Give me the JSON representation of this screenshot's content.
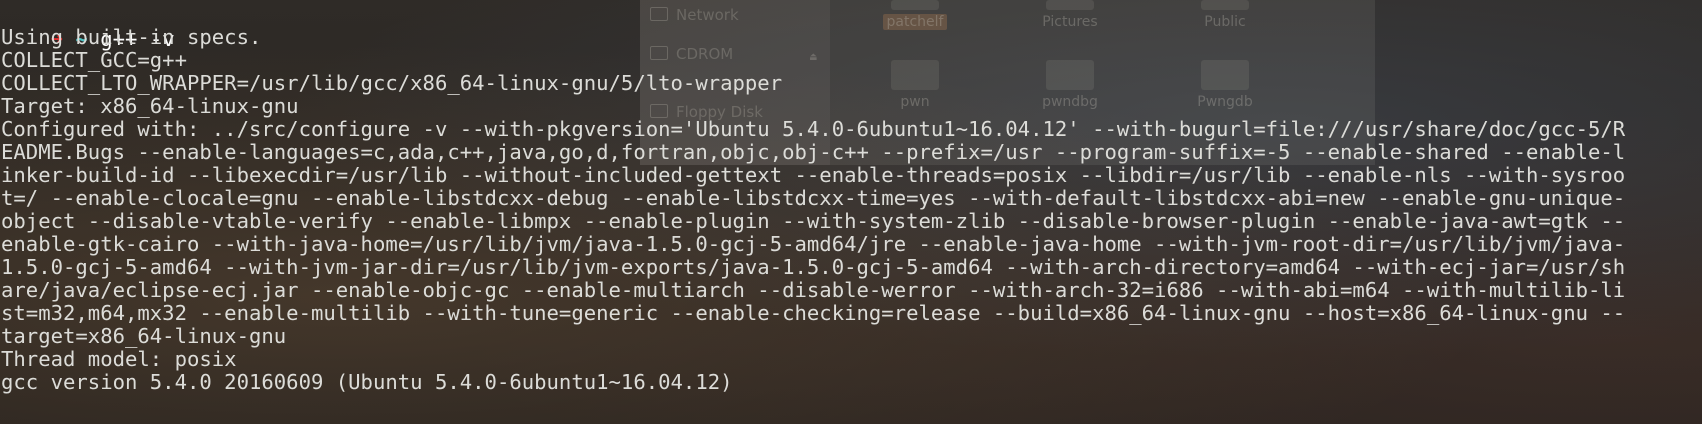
{
  "desktop": {
    "file_manager": {
      "sidebar": [
        "Network",
        "CDROM",
        "Floppy Disk"
      ],
      "folders": [
        {
          "label": "patchelf",
          "selected": true
        },
        {
          "label": "Pictures",
          "selected": false
        },
        {
          "label": "Public",
          "selected": false
        },
        {
          "label": "pwn",
          "selected": false
        },
        {
          "label": "pwndbg",
          "selected": false
        },
        {
          "label": "Pwngdb",
          "selected": false
        }
      ],
      "eject_icon": "eject-icon"
    }
  },
  "terminal": {
    "prompt": {
      "arrow": "➜",
      "cwd": "~",
      "command": "g++ -v"
    },
    "output": [
      "Using built-in specs.",
      "COLLECT_GCC=g++",
      "COLLECT_LTO_WRAPPER=/usr/lib/gcc/x86_64-linux-gnu/5/lto-wrapper",
      "Target: x86_64-linux-gnu",
      "Configured with: ../src/configure -v --with-pkgversion='Ubuntu 5.4.0-6ubuntu1~16.04.12' --with-bugurl=file:///usr/share/doc/gcc-5/R",
      "EADME.Bugs --enable-languages=c,ada,c++,java,go,d,fortran,objc,obj-c++ --prefix=/usr --program-suffix=-5 --enable-shared --enable-l",
      "inker-build-id --libexecdir=/usr/lib --without-included-gettext --enable-threads=posix --libdir=/usr/lib --enable-nls --with-sysroo",
      "t=/ --enable-clocale=gnu --enable-libstdcxx-debug --enable-libstdcxx-time=yes --with-default-libstdcxx-abi=new --enable-gnu-unique-",
      "object --disable-vtable-verify --enable-libmpx --enable-plugin --with-system-zlib --disable-browser-plugin --enable-java-awt=gtk --",
      "enable-gtk-cairo --with-java-home=/usr/lib/jvm/java-1.5.0-gcj-5-amd64/jre --enable-java-home --with-jvm-root-dir=/usr/lib/jvm/java-",
      "1.5.0-gcj-5-amd64 --with-jvm-jar-dir=/usr/lib/jvm-exports/java-1.5.0-gcj-5-amd64 --with-arch-directory=amd64 --with-ecj-jar=/usr/sh",
      "are/java/eclipse-ecj.jar --enable-objc-gc --enable-multiarch --disable-werror --with-arch-32=i686 --with-abi=m64 --with-multilib-li",
      "st=m32,m64,mx32 --enable-multilib --with-tune=generic --enable-checking=release --build=x86_64-linux-gnu --host=x86_64-linux-gnu --",
      "target=x86_64-linux-gnu",
      "Thread model: posix",
      "gcc version 5.4.0 20160609 (Ubuntu 5.4.0-6ubuntu1~16.04.12)"
    ]
  },
  "colors": {
    "prompt_arrow": "#e83030",
    "prompt_cwd": "#4ec3c3",
    "text": "#dcdcd8"
  }
}
